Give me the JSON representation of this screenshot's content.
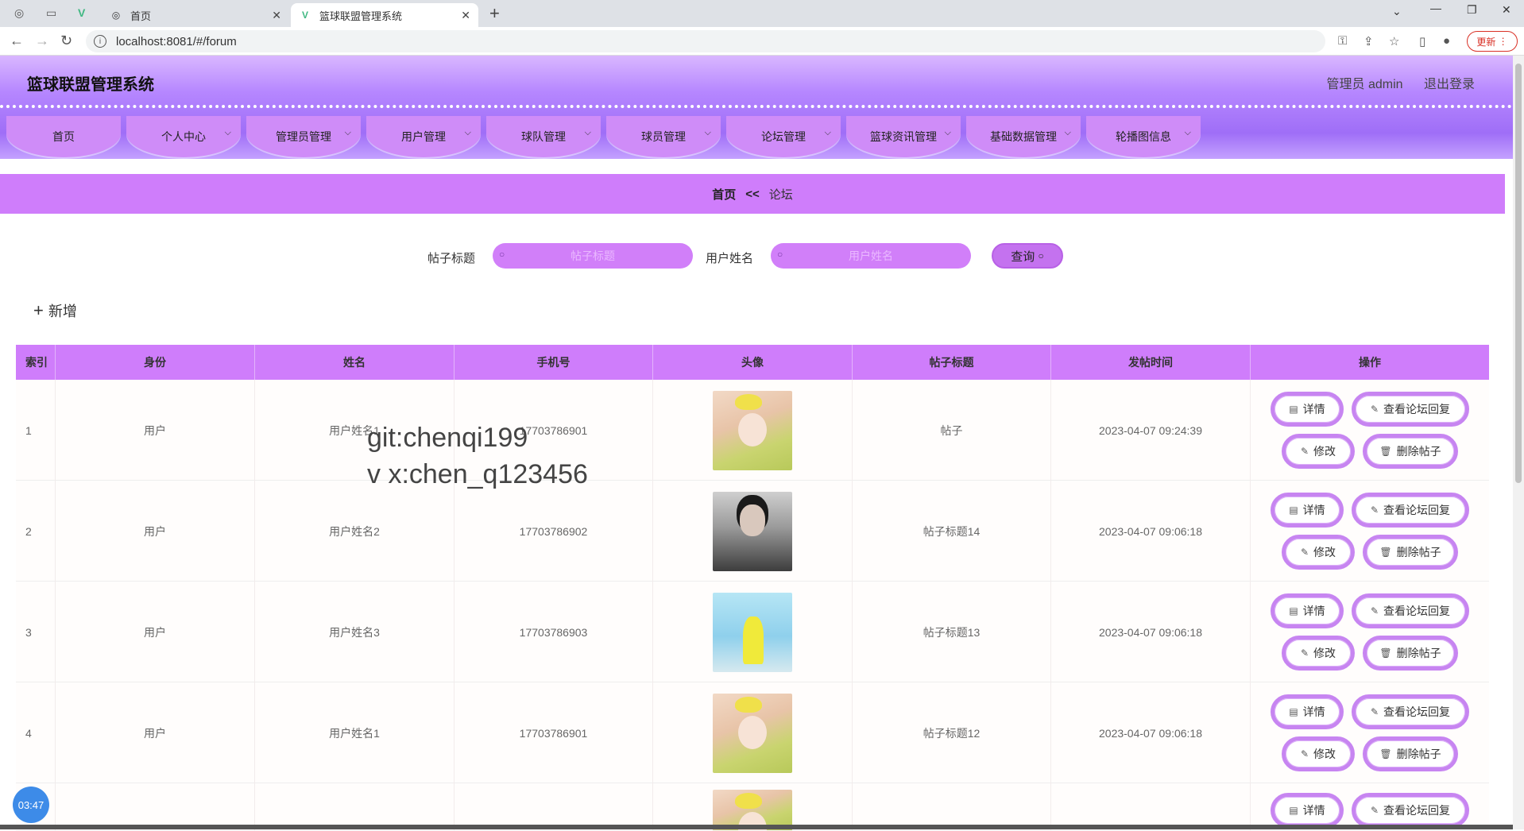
{
  "browser": {
    "tabs": [
      {
        "title": "首页",
        "active": false
      },
      {
        "title": "篮球联盟管理系统",
        "active": true
      }
    ],
    "url": "localhost:8081/#/forum",
    "update_label": "更新"
  },
  "header": {
    "title": "篮球联盟管理系统",
    "user_label": "管理员 admin",
    "logout_label": "退出登录"
  },
  "menu": [
    {
      "label": "首页",
      "has_dropdown": false
    },
    {
      "label": "个人中心",
      "has_dropdown": true
    },
    {
      "label": "管理员管理",
      "has_dropdown": true
    },
    {
      "label": "用户管理",
      "has_dropdown": true
    },
    {
      "label": "球队管理",
      "has_dropdown": true
    },
    {
      "label": "球员管理",
      "has_dropdown": true
    },
    {
      "label": "论坛管理",
      "has_dropdown": true
    },
    {
      "label": "篮球资讯管理",
      "has_dropdown": true
    },
    {
      "label": "基础数据管理",
      "has_dropdown": true
    },
    {
      "label": "轮播图信息",
      "has_dropdown": true
    }
  ],
  "breadcrumb": {
    "home": "首页",
    "sep": "<<",
    "current": "论坛"
  },
  "search": {
    "title_label": "帖子标题",
    "title_placeholder": "帖子标题",
    "name_label": "用户姓名",
    "name_placeholder": "用户姓名",
    "query_label": "查询"
  },
  "add_label": "新增",
  "table": {
    "headers": [
      "索引",
      "身份",
      "姓名",
      "手机号",
      "头像",
      "帖子标题",
      "发帖时间",
      "操作"
    ],
    "rows": [
      {
        "index": "1",
        "role": "用户",
        "name": "用户姓名1",
        "phone": "17703786901",
        "avatar": "anime-girl-avatar",
        "title": "帖子",
        "time": "2023-04-07 09:24:39"
      },
      {
        "index": "2",
        "role": "用户",
        "name": "用户姓名2",
        "phone": "17703786902",
        "avatar": "man-portrait-avatar",
        "title": "帖子标题14",
        "time": "2023-04-07 09:06:18"
      },
      {
        "index": "3",
        "role": "用户",
        "name": "用户姓名3",
        "phone": "17703786903",
        "avatar": "girl-beach-avatar",
        "title": "帖子标题13",
        "time": "2023-04-07 09:06:18"
      },
      {
        "index": "4",
        "role": "用户",
        "name": "用户姓名1",
        "phone": "17703786901",
        "avatar": "anime-girl-avatar",
        "title": "帖子标题12",
        "time": "2023-04-07 09:06:18"
      }
    ],
    "actions": {
      "detail": "详情",
      "reply": "查看论坛回复",
      "edit": "修改",
      "delete": "删除帖子"
    }
  },
  "watermark": {
    "line1": "git:chenqi199",
    "line2": "v x:chen_q123456"
  },
  "timer": "03:47",
  "colors": {
    "accent": "#cf7dfb",
    "menu": "#cf8cf8",
    "button_border": "#c785f1"
  }
}
